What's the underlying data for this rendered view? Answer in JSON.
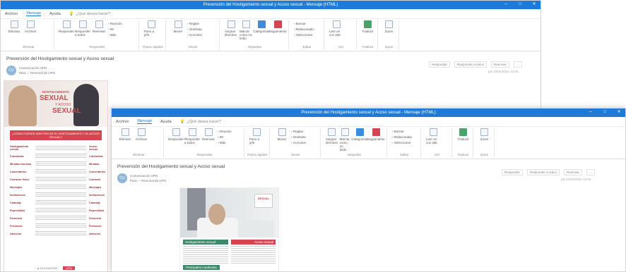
{
  "window1": {
    "title": "Prevención del Hostigamiento sexual y Acoso sexual - Mensaje (HTML)",
    "menu": [
      "Archivo",
      "Mensaje",
      "Ayuda"
    ],
    "menu_active_index": 1,
    "tell_me": "¿Qué desea hacer?",
    "ribbon_groups": [
      {
        "label": "Eliminar",
        "buttons": [
          "Eliminar",
          "Archivar"
        ]
      },
      {
        "label": "Responder",
        "buttons": [
          "Responder",
          "Responder a todos",
          "Reenviar"
        ],
        "small": [
          "Reunión",
          "IM",
          "Más"
        ]
      },
      {
        "label": "Pasos rápidos",
        "buttons": [
          "Paso a jefe"
        ]
      },
      {
        "label": "Mover",
        "buttons": [
          "Mover"
        ],
        "small": [
          "Reglas",
          "OneNote",
          "Acciones"
        ]
      },
      {
        "label": "Etiquetas",
        "buttons": [
          "Asignar directiva",
          "Marcar como no leído",
          "Categorizar",
          "Seguimiento"
        ]
      },
      {
        "label": "Editar",
        "small": [
          "Buscar",
          "Relacionado",
          "Seleccionar"
        ]
      },
      {
        "label": "Voz",
        "buttons": [
          "Leer en voz alta"
        ]
      },
      {
        "label": "Traducir",
        "buttons": [
          "Traducir"
        ]
      },
      {
        "label": "Zoom",
        "buttons": [
          "Zoom"
        ]
      }
    ],
    "subject": "Prevención del Hostigamiento sexual y Acoso sexual",
    "sender": {
      "name": "Comunicación UPN",
      "line2": "Para: ○ Personal de UPN",
      "initials": "CU"
    },
    "actions": [
      "Responder",
      "Responder a todos",
      "Reenviar",
      "..."
    ],
    "date": "jue 22/04/2021 12:05"
  },
  "poster1": {
    "tag": "HOSTIGAMIENTO",
    "word1": "SEXUAL",
    "conj": "Y ACOSO",
    "word2": "SEXUAL",
    "banner": "¿CÓMO PUEDES IDENTIFICAR EL HOSTIGAMIENTO Y EL ACOSO SEXUAL?",
    "rows": [
      {
        "k": "Hostigamiento sexual",
        "r": "Acoso sexual"
      },
      {
        "k": "Conductas",
        "r": "Conductas"
      },
      {
        "k": "Miradas lascivas",
        "r": "Miradas"
      },
      {
        "k": "Comentarios",
        "r": "Comentarios"
      },
      {
        "k": "Contacto físico",
        "r": "Contacto"
      },
      {
        "k": "Mensajes",
        "r": "Mensajes"
      },
      {
        "k": "Invitaciones",
        "r": "Invitaciones"
      },
      {
        "k": "Chantaje",
        "r": "Chantaje"
      },
      {
        "k": "Represalias",
        "r": "Represalias"
      },
      {
        "k": "Denuncia",
        "r": "Denuncia"
      },
      {
        "k": "Protocolo",
        "r": "Protocolo"
      },
      {
        "k": "Atención",
        "r": "Atención"
      }
    ],
    "footer": [
      "▲ EDUCACIÓN",
      "UPN"
    ]
  },
  "window2": {
    "title": "Prevención del Hostigamiento sexual y Acoso sexual - Mensaje (HTML)",
    "subject": "Prevención del Hostigamiento sexual y Acoso sexual",
    "sender": {
      "name": "Comunicación UPN",
      "line2": "Para: ○ Personal de UPN",
      "initials": "CU"
    },
    "actions": [
      "Responder",
      "Responder a todos",
      "Reenviar",
      "..."
    ],
    "date": "jue 22/04/2021 12:05"
  },
  "poster2": {
    "sign": "SEXUAL",
    "col1": "Hostigamiento sexual",
    "col2": "Acoso sexual",
    "bottom": "Principales conductas"
  }
}
